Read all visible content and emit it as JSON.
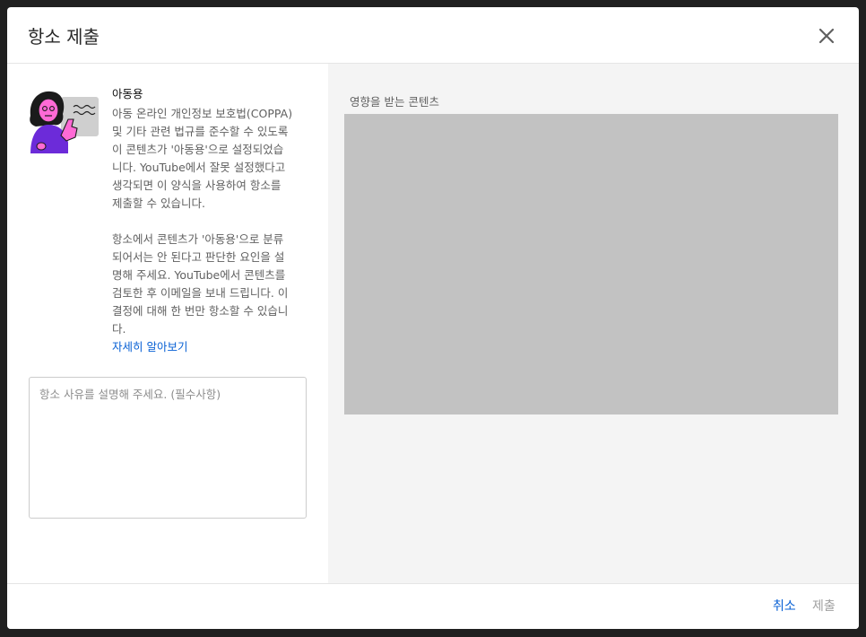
{
  "dialog": {
    "title": "항소 제출"
  },
  "info": {
    "title": "아동용",
    "paragraph1": "아동 온라인 개인정보 보호법(COPPA)\n및 기타 관련 법규를 준수할 수 있도록\n이 콘텐츠가 '아동용'으로 설정되었습\n니다. YouTube에서 잘못 설정했다고\n생각되면 이 양식을 사용하여 항소를\n제출할 수 있습니다.",
    "paragraph2": "항소에서 콘텐츠가 '아동용'으로 분류\n되어서는 안 된다고 판단한 요인을 설\n명해 주세요. YouTube에서 콘텐츠를\n검토한 후 이메일을 보내 드립니다. 이\n결정에 대해 한 번만 항소할 수 있습니\n다.",
    "learn_more": "자세히 알아보기"
  },
  "reason": {
    "placeholder": "항소 사유를 설명해 주세요. (필수사항)",
    "value": ""
  },
  "affected": {
    "label": "영향을 받는 콘텐츠"
  },
  "footer": {
    "cancel_label": "취소",
    "submit_label": "제출"
  },
  "icons": {
    "close": "close-icon",
    "illustration": "kids-content-illustration"
  },
  "colors": {
    "link": "#065fd4",
    "disabled": "#a0a0a0",
    "thumb_placeholder": "#c2c2c2",
    "illustration_purple": "#6c2bd9",
    "illustration_pink": "#ff4fd8"
  }
}
